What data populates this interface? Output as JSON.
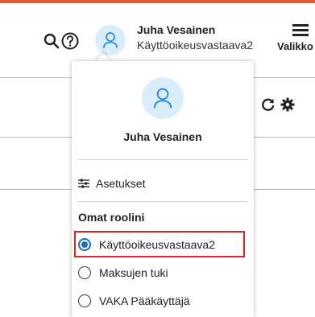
{
  "header": {
    "user_name": "Juha Vesainen",
    "user_role": "Käyttöoikeusvastaava2",
    "menu_label": "Valikko",
    "icons": {
      "search": "search-icon",
      "help": "help-icon",
      "user": "user-icon",
      "menu": "hamburger-menu-icon",
      "refresh": "refresh-icon",
      "settings": "gear-icon"
    }
  },
  "dropdown": {
    "user_name": "Juha Vesainen",
    "settings_label": "Asetukset",
    "roles_title": "Omat roolini",
    "roles": [
      {
        "label": "Käyttöoikeusvastaava2",
        "selected": true
      },
      {
        "label": "Maksujen tuki",
        "selected": false
      },
      {
        "label": "VAKA Pääkäyttäjä",
        "selected": false
      }
    ]
  },
  "colors": {
    "accent_top": "#e4592a",
    "avatar_bg": "#d9eefa",
    "avatar_icon": "#2f8ee0",
    "radio_selected": "#1a6fbd",
    "highlight": "#e02424"
  }
}
